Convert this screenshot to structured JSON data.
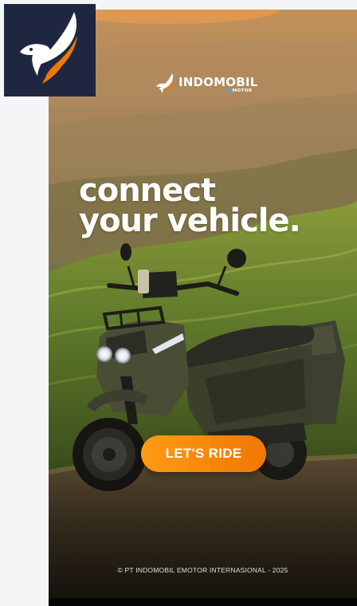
{
  "brand": {
    "name": "INDOMOBIL",
    "sub": "MOTOR",
    "accent": "#f07804",
    "icon_bg": "#1f2740"
  },
  "hero": {
    "line1": "connect",
    "line2": "your vehicle."
  },
  "cta": {
    "label": "LET'S RIDE",
    "color": "#ff8c0c"
  },
  "footer": {
    "copyright": "© PT INDOMOBIL EMOTOR INTERNASIONAL - 2025"
  },
  "icons": {
    "app_icon": "phoenix-logo-icon",
    "brand_mark": "phoenix-mark-icon"
  }
}
